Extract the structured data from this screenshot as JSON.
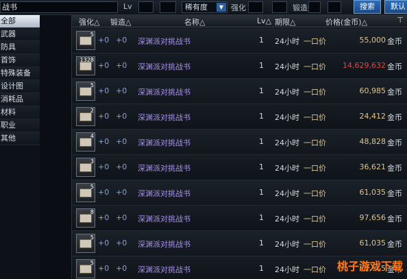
{
  "search": {
    "value": "战书"
  },
  "filters": {
    "lv_label": "Lv",
    "rarity": "稀有度",
    "strengthen_label": "强化",
    "forge_label": "锻造"
  },
  "buttons": {
    "search": "搜索",
    "default": "默认"
  },
  "categories": [
    {
      "label": "全部",
      "active": true
    },
    {
      "label": "武器"
    },
    {
      "label": "防具"
    },
    {
      "label": "首饰"
    },
    {
      "label": "特殊装备"
    },
    {
      "label": "设计图"
    },
    {
      "label": "消耗品"
    },
    {
      "label": "材料"
    },
    {
      "label": "职业"
    },
    {
      "label": "其他"
    }
  ],
  "columns": {
    "strengthen": "强化△",
    "forge": "锻造△",
    "name": "名称△",
    "level": "Lv△",
    "duration": "期限△",
    "price": "价格(金币)△"
  },
  "rows": [
    {
      "qty": "5",
      "strengthen": "+0",
      "forge": "+0",
      "name": "深渊派对挑战书",
      "lv": "1",
      "time": "24小时",
      "type": "一口价",
      "price": "55,000",
      "currency": "金币",
      "red": false
    },
    {
      "qty": "1328",
      "strengthen": "+0",
      "forge": "+0",
      "name": "深渊派对挑战书",
      "lv": "1",
      "time": "24小时",
      "type": "一口价",
      "price": "14,629,632",
      "currency": "金币",
      "red": true
    },
    {
      "qty": "5",
      "strengthen": "+0",
      "forge": "+0",
      "name": "深渊派对挑战书",
      "lv": "1",
      "time": "24小时",
      "type": "一口价",
      "price": "60,985",
      "currency": "金币",
      "red": false
    },
    {
      "qty": "2",
      "strengthen": "+0",
      "forge": "+0",
      "name": "深渊派对挑战书",
      "lv": "1",
      "time": "24小时",
      "type": "一口价",
      "price": "24,412",
      "currency": "金币",
      "red": false
    },
    {
      "qty": "4",
      "strengthen": "+0",
      "forge": "+0",
      "name": "深渊派对挑战书",
      "lv": "1",
      "time": "24小时",
      "type": "一口价",
      "price": "48,828",
      "currency": "金币",
      "red": false
    },
    {
      "qty": "3",
      "strengthen": "+0",
      "forge": "+0",
      "name": "深渊派对挑战书",
      "lv": "1",
      "time": "24小时",
      "type": "一口价",
      "price": "36,621",
      "currency": "金币",
      "red": false
    },
    {
      "qty": "5",
      "strengthen": "+0",
      "forge": "+0",
      "name": "深渊派对挑战书",
      "lv": "1",
      "time": "24小时",
      "type": "一口价",
      "price": "61,035",
      "currency": "金币",
      "red": false
    },
    {
      "qty": "8",
      "strengthen": "+0",
      "forge": "+0",
      "name": "深渊派对挑战书",
      "lv": "1",
      "time": "24小时",
      "type": "一口价",
      "price": "97,656",
      "currency": "金币",
      "red": false
    },
    {
      "qty": "5",
      "strengthen": "+0",
      "forge": "+0",
      "name": "深渊派对挑战书",
      "lv": "1",
      "time": "24小时",
      "type": "一口价",
      "price": "61,035",
      "currency": "金币",
      "red": false
    },
    {
      "qty": "5",
      "strengthen": "+0",
      "forge": "+0",
      "name": "深渊派对挑战书",
      "lv": "1",
      "time": "24小时",
      "type": "一口价",
      "price": "61,035",
      "currency": "金币",
      "red": false
    }
  ],
  "watermark": "桃子游戏下载",
  "colors": {
    "accent": "#2d6db8",
    "name_purple": "#a78ff0",
    "price_gold": "#e2c48a",
    "price_red": "#e04646"
  }
}
